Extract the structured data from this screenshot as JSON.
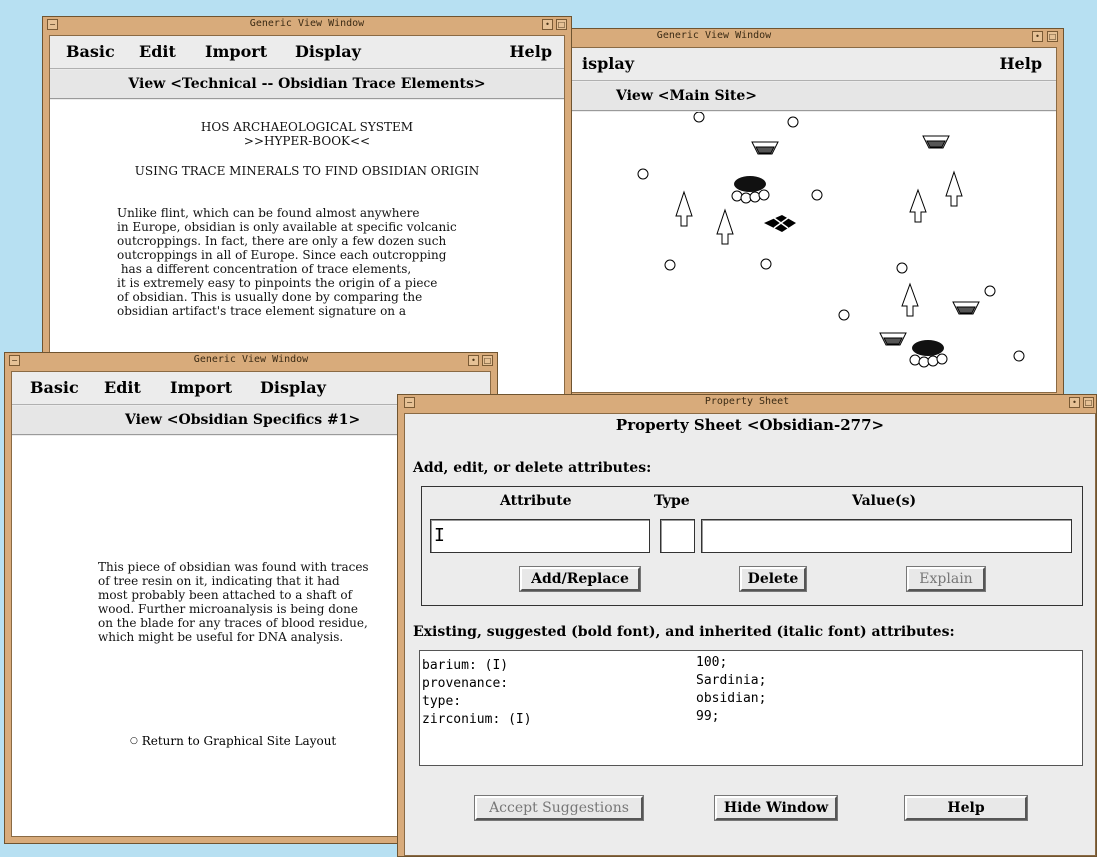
{
  "window_title": "Generic View Window",
  "menus": {
    "basic": "Basic",
    "edit": "Edit",
    "import": "Import",
    "display": "Display",
    "help": "Help",
    "display_partial": "isplay"
  },
  "tech": {
    "view": "View <Technical -- Obsidian Trace Elements>",
    "header1": "HOS ARCHAEOLOGICAL SYSTEM",
    "header2": ">>HYPER-BOOK<<",
    "section": "USING TRACE MINERALS TO FIND OBSIDIAN ORIGIN",
    "lines": [
      "Unlike flint, which can be found almost anywhere",
      "in Europe, obsidian is only available at specific volcanic",
      "outcroppings. In fact, there are only a few dozen such",
      "outcroppings in all of Europe. Since each outcropping",
      " has a different concentration of trace elements,",
      "it is extremely easy to pinpoints the origin of a piece",
      "of obsidian. This is usually done by comparing the",
      "obsidian artifact's trace element signature on a"
    ]
  },
  "site": {
    "view": "View <Main Site>"
  },
  "spec": {
    "view": "View <Obsidian Specifics #1>",
    "lines": [
      "This piece of obsidian was found with traces",
      "of tree resin on it, indicating that it had",
      "most probably been attached to a shaft of",
      "wood. Further microanalysis is being done",
      "on the blade for any traces of blood residue,",
      "which might be useful for DNA analysis."
    ],
    "link": "Return to Graphical Site Layout"
  },
  "prop": {
    "window_title": "Property Sheet",
    "heading": "Property Sheet <Obsidian-277>",
    "add_label": "Add, edit, or delete attributes:",
    "col_attribute": "Attribute",
    "col_type": "Type",
    "col_values": "Value(s)",
    "attribute_value": "",
    "type_value": "",
    "values_value": "",
    "btn_add": "Add/Replace",
    "btn_delete": "Delete",
    "btn_explain": "Explain",
    "existing_label": "Existing, suggested (bold font), and inherited (italic font) attributes:",
    "attributes": [
      {
        "name": "barium: (I)",
        "value": "100;"
      },
      {
        "name": "provenance:",
        "value": "Sardinia;"
      },
      {
        "name": "type:",
        "value": "obsidian;"
      },
      {
        "name": "zirconium: (I)",
        "value": "99;"
      }
    ],
    "btn_accept": "Accept Suggestions",
    "btn_hide": "Hide Window",
    "btn_help": "Help"
  },
  "colors": {
    "desktop": "#b7e0f2",
    "frame": "#d8ab7b",
    "panel": "#ececec"
  }
}
